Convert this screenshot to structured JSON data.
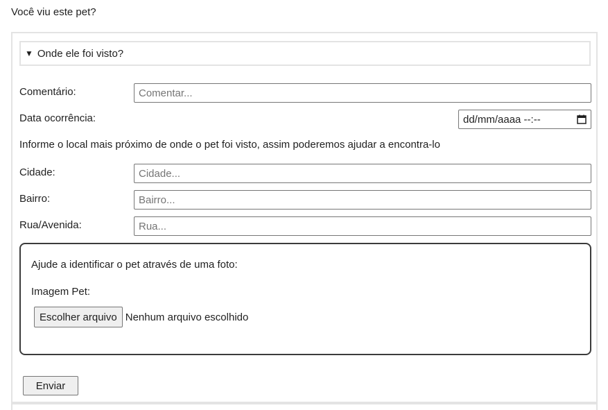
{
  "page": {
    "title": "Você viu este pet?"
  },
  "details": {
    "summary": "Onde ele foi visto?"
  },
  "form": {
    "comment": {
      "label": "Comentário:",
      "placeholder": "Comentar..."
    },
    "date": {
      "label": "Data ocorrência:",
      "value": "dd/mm/aaaa --:--"
    },
    "info": "Informe o local mais próximo de onde o pet foi visto, assim poderemos ajudar a encontra-lo",
    "city": {
      "label": "Cidade:",
      "placeholder": "Cidade..."
    },
    "neighborhood": {
      "label": "Bairro:",
      "placeholder": "Bairro..."
    },
    "street": {
      "label": "Rua/Avenida:",
      "placeholder": "Rua..."
    }
  },
  "photo": {
    "title": "Ajude a identificar o pet através de uma foto:",
    "label": "Imagem Pet:",
    "button": "Escolher arquivo",
    "status": "Nenhum arquivo escolhido"
  },
  "submit": {
    "label": "Enviar"
  }
}
